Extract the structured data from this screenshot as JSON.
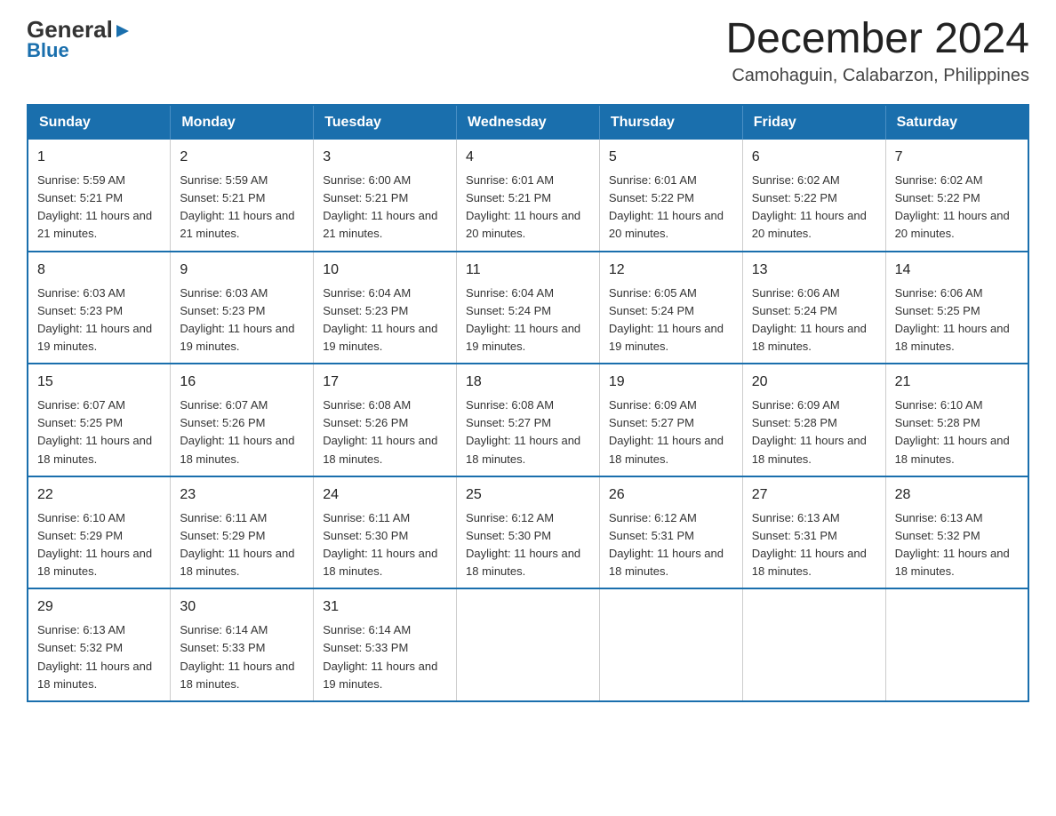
{
  "header": {
    "logo_general": "General",
    "logo_blue": "Blue",
    "month_title": "December 2024",
    "location": "Camohaguin, Calabarzon, Philippines"
  },
  "days_of_week": [
    "Sunday",
    "Monday",
    "Tuesday",
    "Wednesday",
    "Thursday",
    "Friday",
    "Saturday"
  ],
  "weeks": [
    [
      {
        "day": "1",
        "sunrise": "5:59 AM",
        "sunset": "5:21 PM",
        "daylight": "11 hours and 21 minutes."
      },
      {
        "day": "2",
        "sunrise": "5:59 AM",
        "sunset": "5:21 PM",
        "daylight": "11 hours and 21 minutes."
      },
      {
        "day": "3",
        "sunrise": "6:00 AM",
        "sunset": "5:21 PM",
        "daylight": "11 hours and 21 minutes."
      },
      {
        "day": "4",
        "sunrise": "6:01 AM",
        "sunset": "5:21 PM",
        "daylight": "11 hours and 20 minutes."
      },
      {
        "day": "5",
        "sunrise": "6:01 AM",
        "sunset": "5:22 PM",
        "daylight": "11 hours and 20 minutes."
      },
      {
        "day": "6",
        "sunrise": "6:02 AM",
        "sunset": "5:22 PM",
        "daylight": "11 hours and 20 minutes."
      },
      {
        "day": "7",
        "sunrise": "6:02 AM",
        "sunset": "5:22 PM",
        "daylight": "11 hours and 20 minutes."
      }
    ],
    [
      {
        "day": "8",
        "sunrise": "6:03 AM",
        "sunset": "5:23 PM",
        "daylight": "11 hours and 19 minutes."
      },
      {
        "day": "9",
        "sunrise": "6:03 AM",
        "sunset": "5:23 PM",
        "daylight": "11 hours and 19 minutes."
      },
      {
        "day": "10",
        "sunrise": "6:04 AM",
        "sunset": "5:23 PM",
        "daylight": "11 hours and 19 minutes."
      },
      {
        "day": "11",
        "sunrise": "6:04 AM",
        "sunset": "5:24 PM",
        "daylight": "11 hours and 19 minutes."
      },
      {
        "day": "12",
        "sunrise": "6:05 AM",
        "sunset": "5:24 PM",
        "daylight": "11 hours and 19 minutes."
      },
      {
        "day": "13",
        "sunrise": "6:06 AM",
        "sunset": "5:24 PM",
        "daylight": "11 hours and 18 minutes."
      },
      {
        "day": "14",
        "sunrise": "6:06 AM",
        "sunset": "5:25 PM",
        "daylight": "11 hours and 18 minutes."
      }
    ],
    [
      {
        "day": "15",
        "sunrise": "6:07 AM",
        "sunset": "5:25 PM",
        "daylight": "11 hours and 18 minutes."
      },
      {
        "day": "16",
        "sunrise": "6:07 AM",
        "sunset": "5:26 PM",
        "daylight": "11 hours and 18 minutes."
      },
      {
        "day": "17",
        "sunrise": "6:08 AM",
        "sunset": "5:26 PM",
        "daylight": "11 hours and 18 minutes."
      },
      {
        "day": "18",
        "sunrise": "6:08 AM",
        "sunset": "5:27 PM",
        "daylight": "11 hours and 18 minutes."
      },
      {
        "day": "19",
        "sunrise": "6:09 AM",
        "sunset": "5:27 PM",
        "daylight": "11 hours and 18 minutes."
      },
      {
        "day": "20",
        "sunrise": "6:09 AM",
        "sunset": "5:28 PM",
        "daylight": "11 hours and 18 minutes."
      },
      {
        "day": "21",
        "sunrise": "6:10 AM",
        "sunset": "5:28 PM",
        "daylight": "11 hours and 18 minutes."
      }
    ],
    [
      {
        "day": "22",
        "sunrise": "6:10 AM",
        "sunset": "5:29 PM",
        "daylight": "11 hours and 18 minutes."
      },
      {
        "day": "23",
        "sunrise": "6:11 AM",
        "sunset": "5:29 PM",
        "daylight": "11 hours and 18 minutes."
      },
      {
        "day": "24",
        "sunrise": "6:11 AM",
        "sunset": "5:30 PM",
        "daylight": "11 hours and 18 minutes."
      },
      {
        "day": "25",
        "sunrise": "6:12 AM",
        "sunset": "5:30 PM",
        "daylight": "11 hours and 18 minutes."
      },
      {
        "day": "26",
        "sunrise": "6:12 AM",
        "sunset": "5:31 PM",
        "daylight": "11 hours and 18 minutes."
      },
      {
        "day": "27",
        "sunrise": "6:13 AM",
        "sunset": "5:31 PM",
        "daylight": "11 hours and 18 minutes."
      },
      {
        "day": "28",
        "sunrise": "6:13 AM",
        "sunset": "5:32 PM",
        "daylight": "11 hours and 18 minutes."
      }
    ],
    [
      {
        "day": "29",
        "sunrise": "6:13 AM",
        "sunset": "5:32 PM",
        "daylight": "11 hours and 18 minutes."
      },
      {
        "day": "30",
        "sunrise": "6:14 AM",
        "sunset": "5:33 PM",
        "daylight": "11 hours and 18 minutes."
      },
      {
        "day": "31",
        "sunrise": "6:14 AM",
        "sunset": "5:33 PM",
        "daylight": "11 hours and 19 minutes."
      },
      null,
      null,
      null,
      null
    ]
  ],
  "labels": {
    "sunrise": "Sunrise:",
    "sunset": "Sunset:",
    "daylight": "Daylight:"
  }
}
